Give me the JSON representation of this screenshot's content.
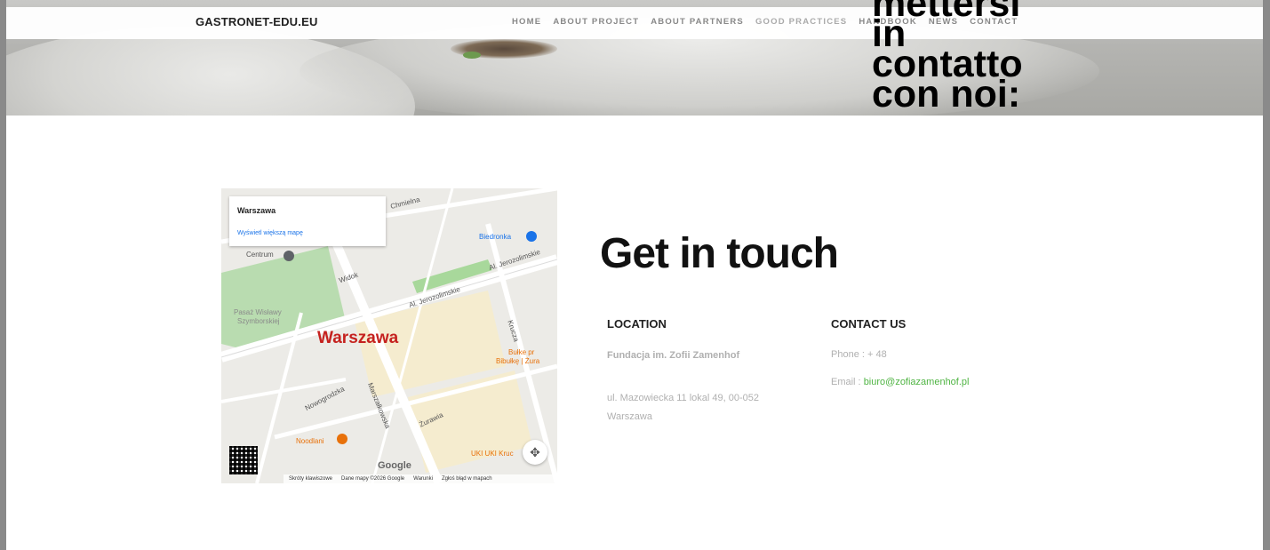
{
  "navbar": {
    "brand": "GASTRONET-EDU.EU",
    "items": [
      "HOME",
      "ABOUT PROJECT",
      "ABOUT PARTNERS",
      "GOOD PRACTICES",
      "HANDBOOK",
      "NEWS",
      "CONTACT"
    ]
  },
  "overlay_heading": {
    "lines": [
      "mettersi",
      "in",
      "contatto",
      "con noi:"
    ]
  },
  "map": {
    "card_title": "Warszawa",
    "card_link": "Wyświetl większą mapę",
    "city_label": "Warszawa",
    "places": {
      "centrum": "Centrum",
      "biedronka": "Biedronka",
      "pasaz_1": "Pasaż Wisławy",
      "pasaz_2": "Szymborskiej",
      "bulke_1": "Bułke pr",
      "bulke_2": "Bibułkę | Żura",
      "noodlani": "Noodlani",
      "uki": "UKI UKI Kruc"
    },
    "streets": {
      "widok": "Widok",
      "jerozolimskie_1": "Al. Jerozolimskie",
      "jerozolimskie_2": "Al. Jerozolimskie",
      "chmielna": "Chmielna",
      "nowogrodzka": "Nowogrodzka",
      "marszalkowska": "Marszałkowska",
      "zurawia": "Żurawia",
      "krucza": "Krucza"
    },
    "google_logo": "Google",
    "footer": [
      "Skróty klawiszowe",
      "Dane mapy ©2026 Google",
      "Warunki",
      "Zgłoś błąd w mapach"
    ],
    "colors": {
      "city": "#c5221f",
      "road": "#ffffff",
      "park": "#b9dcb0",
      "block": "#f5eccf"
    }
  },
  "contact": {
    "title": "Get in touch",
    "location": {
      "heading": "LOCATION",
      "org": "Fundacja im. Zofii Zamenhof",
      "address_1": "ul. Mazowiecka 11 lokal 49, 00-052",
      "address_2": "Warszawa"
    },
    "contact_us": {
      "heading": "CONTACT US",
      "phone": "Phone : + 48",
      "email_label": "Email : ",
      "email": "biuro@zofiazamenhof.pl"
    },
    "accent_color": "#4fb443"
  }
}
